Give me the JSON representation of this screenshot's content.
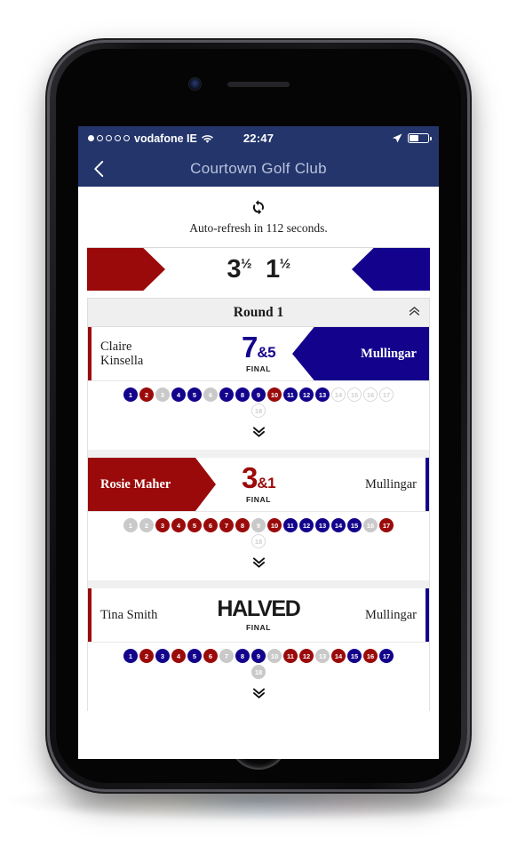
{
  "status_bar": {
    "carrier": "vodafone IE",
    "signal_dots": [
      true,
      false,
      false,
      false,
      false
    ],
    "wifi_icon": "wifi-icon",
    "time": "22:47",
    "location_icon": "location-arrow-icon",
    "battery_icon": "battery-icon",
    "battery_level_pct": 52
  },
  "nav_bar": {
    "back_icon": "chevron-left-icon",
    "title": "Courtown Golf Club"
  },
  "refresh": {
    "icon": "refresh-icon",
    "text": "Auto-refresh in 112 seconds."
  },
  "score_banner": {
    "home_score": "3",
    "home_fraction": "½",
    "away_score": "1",
    "away_fraction": "½",
    "home_color": "#9B0A0A",
    "away_color": "#13028C"
  },
  "round": {
    "label": "Round 1",
    "collapse_icon": "chevron-double-up-icon"
  },
  "colors": {
    "red": "#9B0A0A",
    "blue": "#13028C",
    "grey": "#c9c9c9",
    "navbar": "#23356B"
  },
  "expander_icon": "chevron-double-down-icon",
  "matches": [
    {
      "home_player": "Claire\nKinsella",
      "away_player": "Mullingar",
      "winner": "away",
      "result_score": "7",
      "result_amp": "&5",
      "result_status": "FINAL",
      "left_accent": "red",
      "right_accent": "blue",
      "holes": [
        {
          "n": "1",
          "w": "b"
        },
        {
          "n": "2",
          "w": "r"
        },
        {
          "n": "3",
          "w": "g"
        },
        {
          "n": "4",
          "w": "b"
        },
        {
          "n": "5",
          "w": "b"
        },
        {
          "n": "6",
          "w": "g"
        },
        {
          "n": "7",
          "w": "b"
        },
        {
          "n": "8",
          "w": "b"
        },
        {
          "n": "9",
          "w": "b"
        },
        {
          "n": "10",
          "w": "r"
        },
        {
          "n": "11",
          "w": "b"
        },
        {
          "n": "12",
          "w": "b"
        },
        {
          "n": "13",
          "w": "b"
        },
        {
          "n": "14",
          "w": "n"
        },
        {
          "n": "15",
          "w": "n"
        },
        {
          "n": "16",
          "w": "n"
        },
        {
          "n": "17",
          "w": "n"
        },
        {
          "n": "18",
          "w": "n"
        }
      ]
    },
    {
      "home_player": "Rosie Maher",
      "away_player": "Mullingar",
      "winner": "home",
      "result_score": "3",
      "result_amp": "&1",
      "result_status": "FINAL",
      "left_accent": "red",
      "right_accent": "blue",
      "holes": [
        {
          "n": "1",
          "w": "g"
        },
        {
          "n": "2",
          "w": "g"
        },
        {
          "n": "3",
          "w": "r"
        },
        {
          "n": "4",
          "w": "r"
        },
        {
          "n": "5",
          "w": "r"
        },
        {
          "n": "6",
          "w": "r"
        },
        {
          "n": "7",
          "w": "r"
        },
        {
          "n": "8",
          "w": "r"
        },
        {
          "n": "9",
          "w": "g"
        },
        {
          "n": "10",
          "w": "r"
        },
        {
          "n": "11",
          "w": "b"
        },
        {
          "n": "12",
          "w": "b"
        },
        {
          "n": "13",
          "w": "b"
        },
        {
          "n": "14",
          "w": "b"
        },
        {
          "n": "15",
          "w": "b"
        },
        {
          "n": "16",
          "w": "g"
        },
        {
          "n": "17",
          "w": "r"
        },
        {
          "n": "18",
          "w": "n"
        }
      ]
    },
    {
      "home_player": "Tina Smith",
      "away_player": "Mullingar",
      "winner": "halved",
      "result_score": "HALVED",
      "result_amp": "",
      "result_status": "FINAL",
      "left_accent": "red",
      "right_accent": "blue",
      "holes": [
        {
          "n": "1",
          "w": "b"
        },
        {
          "n": "2",
          "w": "r"
        },
        {
          "n": "3",
          "w": "b"
        },
        {
          "n": "4",
          "w": "r"
        },
        {
          "n": "5",
          "w": "b"
        },
        {
          "n": "6",
          "w": "r"
        },
        {
          "n": "7",
          "w": "g"
        },
        {
          "n": "8",
          "w": "b"
        },
        {
          "n": "9",
          "w": "b"
        },
        {
          "n": "10",
          "w": "g"
        },
        {
          "n": "11",
          "w": "r"
        },
        {
          "n": "12",
          "w": "r"
        },
        {
          "n": "13",
          "w": "g"
        },
        {
          "n": "14",
          "w": "r"
        },
        {
          "n": "15",
          "w": "b"
        },
        {
          "n": "16",
          "w": "r"
        },
        {
          "n": "17",
          "w": "b"
        },
        {
          "n": "18",
          "w": "g"
        }
      ]
    }
  ]
}
